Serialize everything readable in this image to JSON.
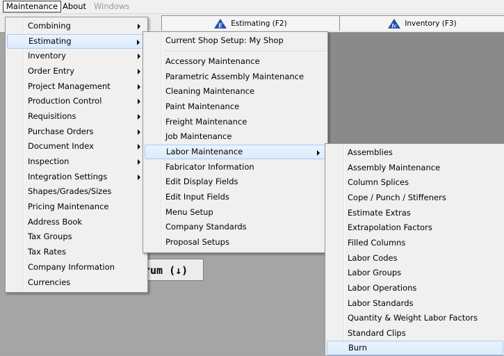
{
  "menubar": {
    "items": [
      {
        "label": "Maintenance",
        "state": "active"
      },
      {
        "label": "About",
        "state": "normal"
      },
      {
        "label": "Windows",
        "state": "disabled"
      }
    ]
  },
  "tabs": [
    {
      "label": "Estimating (F2)",
      "icon": "estimating-icon",
      "letter": "E"
    },
    {
      "label": "Inventory (F3)",
      "icon": "inventory-icon",
      "letter": "Ic"
    }
  ],
  "rum_button": {
    "label": "rum (↓)"
  },
  "maintenance_menu": {
    "items": [
      {
        "label": "Combining",
        "submenu": true
      },
      {
        "label": "Estimating",
        "submenu": true,
        "highlighted": true
      },
      {
        "label": "Inventory",
        "submenu": true
      },
      {
        "label": "Order Entry",
        "submenu": true
      },
      {
        "label": "Project Management",
        "submenu": true
      },
      {
        "label": "Production Control",
        "submenu": true
      },
      {
        "label": "Requisitions",
        "submenu": true
      },
      {
        "label": "Purchase Orders",
        "submenu": true
      },
      {
        "label": "Document Index",
        "submenu": true
      },
      {
        "label": "Inspection",
        "submenu": true
      },
      {
        "label": "Integration Settings",
        "submenu": true
      },
      {
        "label": "Shapes/Grades/Sizes",
        "submenu": false
      },
      {
        "label": "Pricing Maintenance",
        "submenu": false
      },
      {
        "label": "Address Book",
        "submenu": false
      },
      {
        "label": "Tax Groups",
        "submenu": false
      },
      {
        "label": "Tax Rates",
        "submenu": false
      },
      {
        "label": "Company Information",
        "submenu": false
      },
      {
        "label": "Currencies",
        "submenu": false
      }
    ]
  },
  "estimating_menu": {
    "header": "Current Shop Setup: My Shop",
    "items": [
      {
        "label": "Accessory Maintenance",
        "submenu": false
      },
      {
        "label": "Parametric Assembly Maintenance",
        "submenu": false
      },
      {
        "label": "Cleaning Maintenance",
        "submenu": false
      },
      {
        "label": "Paint Maintenance",
        "submenu": false
      },
      {
        "label": "Freight Maintenance",
        "submenu": false
      },
      {
        "label": "Job Maintenance",
        "submenu": false
      },
      {
        "label": "Labor Maintenance",
        "submenu": true,
        "highlighted": true
      },
      {
        "label": "Fabricator Information",
        "submenu": false
      },
      {
        "label": "Edit Display Fields",
        "submenu": false
      },
      {
        "label": "Edit Input Fields",
        "submenu": false
      },
      {
        "label": "Menu Setup",
        "submenu": false
      },
      {
        "label": "Company Standards",
        "submenu": false
      },
      {
        "label": "Proposal Setups",
        "submenu": false
      }
    ]
  },
  "labor_menu": {
    "items": [
      {
        "label": "Assemblies"
      },
      {
        "label": "Assembly Maintenance"
      },
      {
        "label": "Column Splices"
      },
      {
        "label": "Cope / Punch / Stiffeners"
      },
      {
        "label": "Estimate Extras"
      },
      {
        "label": "Extrapolation Factors"
      },
      {
        "label": "Filled Columns"
      },
      {
        "label": "Labor Codes"
      },
      {
        "label": "Labor Groups"
      },
      {
        "label": "Labor Operations"
      },
      {
        "label": "Labor Standards"
      },
      {
        "label": "Quantity & Weight Labor Factors"
      },
      {
        "label": "Standard Clips"
      },
      {
        "label": "Burn",
        "highlighted": true
      }
    ]
  },
  "colors": {
    "tab_icon_blue": "#1f4fa8",
    "highlight": "#dcebfc"
  }
}
